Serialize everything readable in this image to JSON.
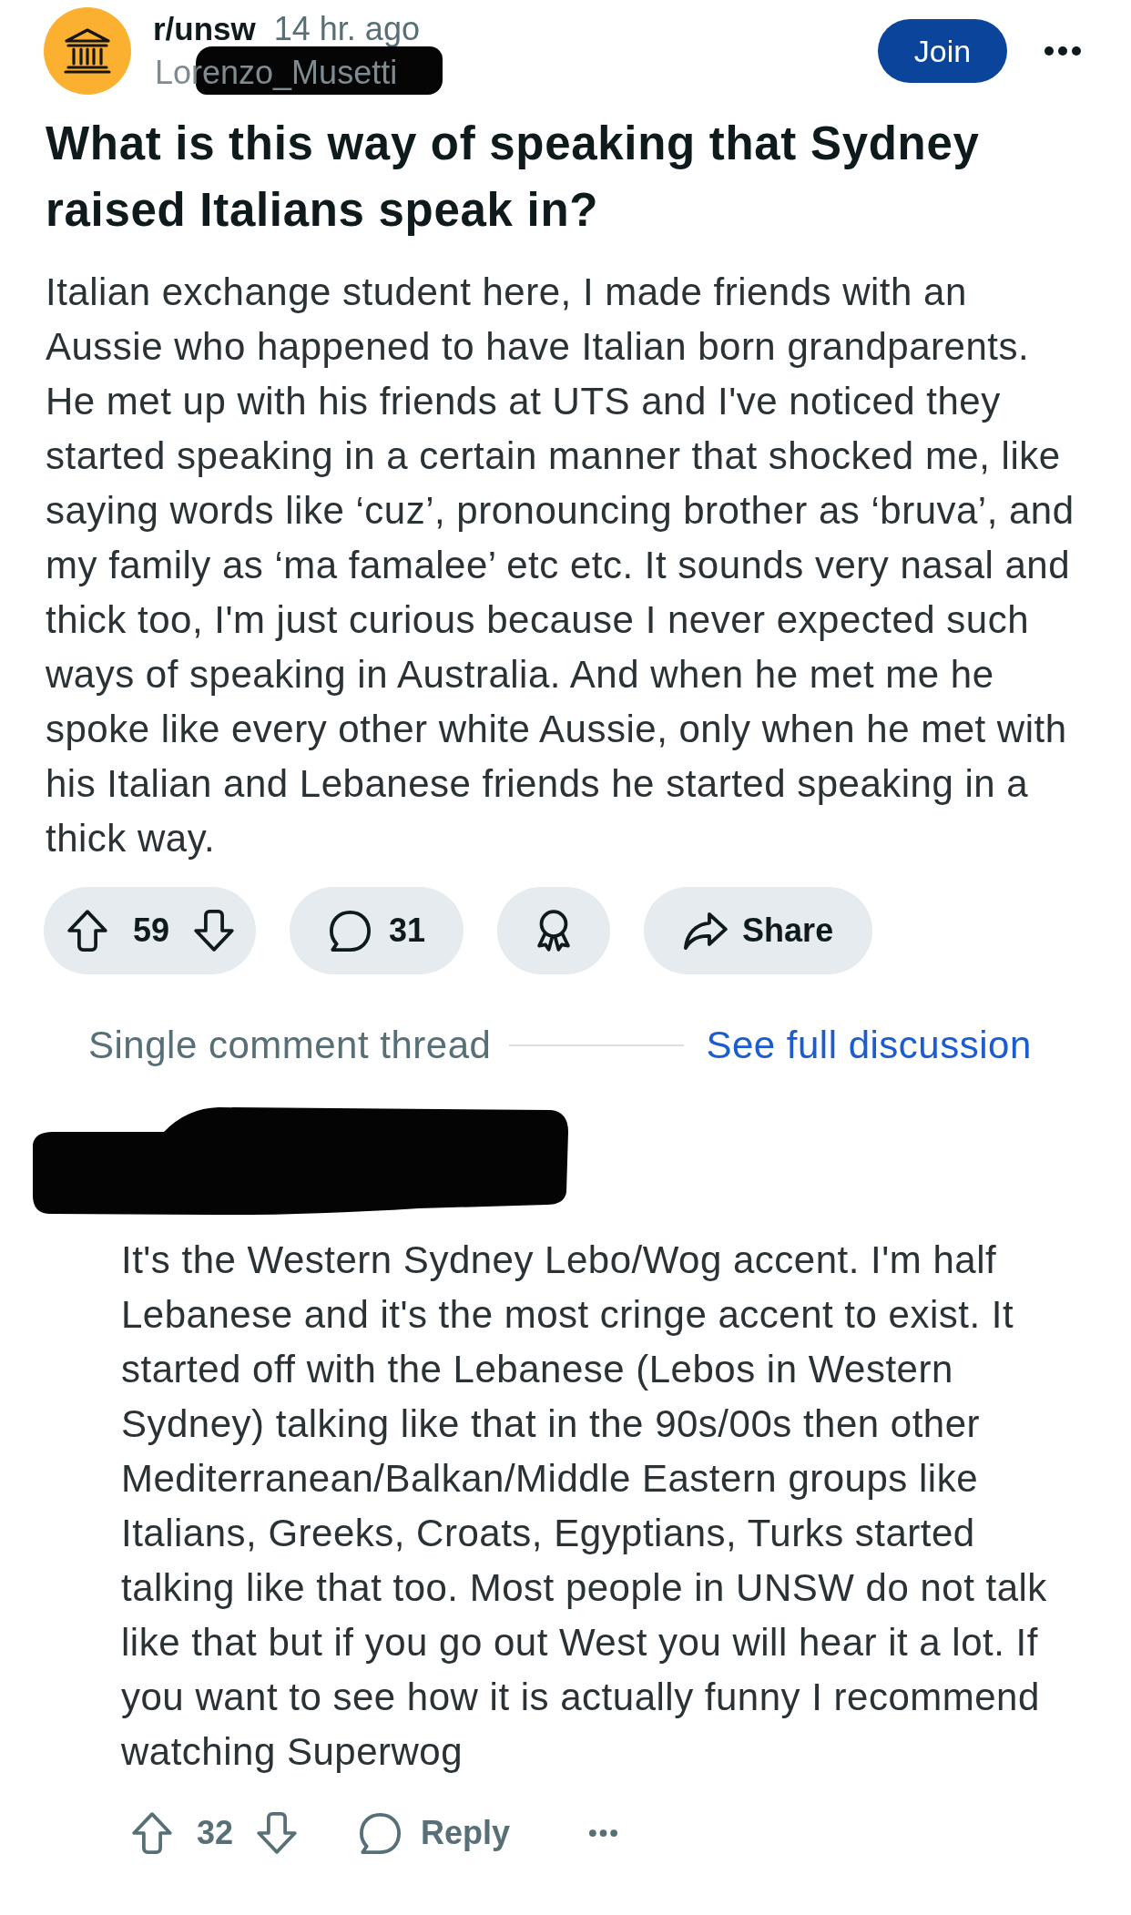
{
  "post": {
    "subreddit": "r/unsw",
    "time": "14 hr. ago",
    "author": "Lorenzo_Musetti",
    "join": "Join",
    "title": "What is this way of speaking that Sydney raised Italians speak in?",
    "body": "Italian exchange student here, I made friends with an Aussie who happened to have Italian born grandparents. He met up with his friends at UTS and I've noticed they started speaking in a certain manner that shocked me, like saying words like ‘cuz’, pronouncing brother as ‘bruva’, and my family as ‘ma famalee’ etc etc. It sounds very nasal and thick too, I'm just curious because I never expected such ways of speaking in Australia. And when he met me he spoke like every other white Aussie, only when he met with his Italian and Lebanese friends he started speaking in a thick way.",
    "actions": [
      {
        "kind": "vote",
        "score": "59"
      },
      {
        "kind": "comments",
        "count": "31"
      },
      {
        "kind": "award"
      },
      {
        "kind": "share",
        "label": "Share"
      }
    ]
  },
  "thread": {
    "label": "Single comment thread",
    "link": "See full discussion"
  },
  "comment": {
    "body": "It's the Western Sydney Lebo/Wog accent. I'm half Lebanese and it's the most cringe accent to exist. It started off with the Lebanese (Lebos in Western Sydney) talking like that in the 90s/00s then other Mediterranean/Balkan/Middle Eastern groups like Italians, Greeks, Croats, Egyptians, Turks started talking like that too. Most people in UNSW do not talk like that but if you go out West you will hear it a lot. If you want to see how it is actually funny I recommend watching Superwog",
    "score": "32",
    "reply": "Reply"
  }
}
